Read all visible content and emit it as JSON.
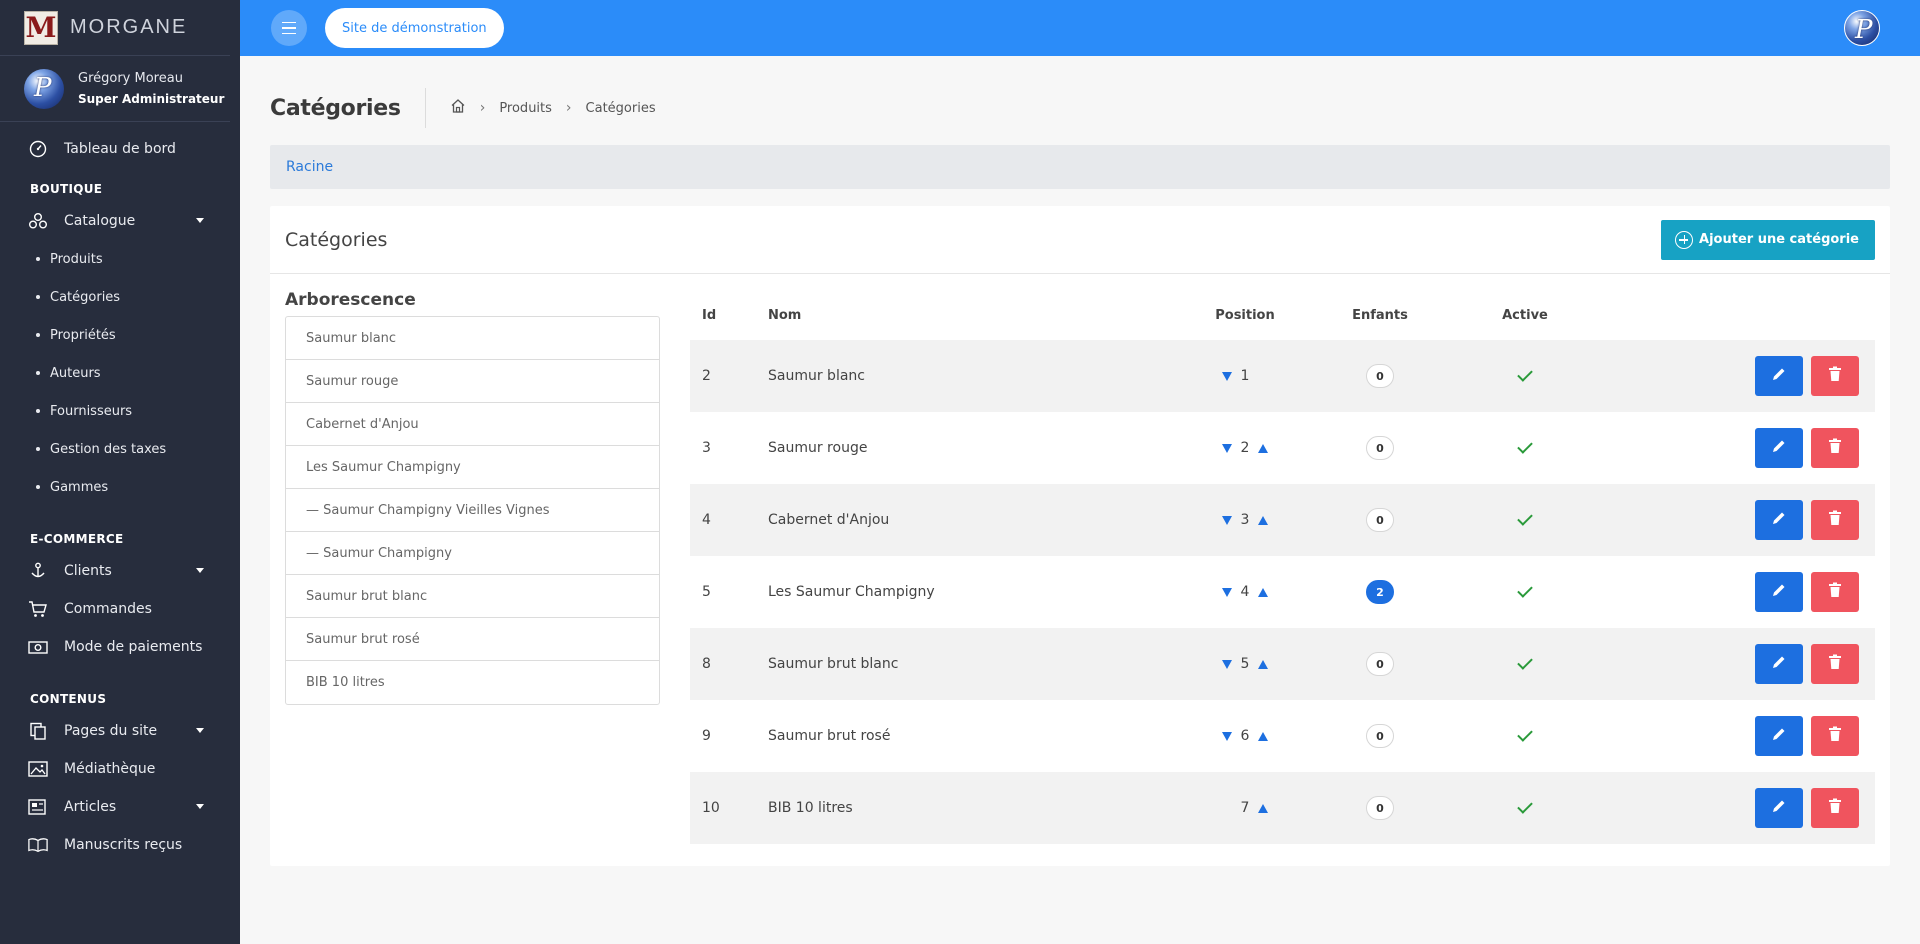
{
  "brand": {
    "logo_letter": "M",
    "name": "MORGANE"
  },
  "user": {
    "name": "Grégory Moreau",
    "role": "Super Administrateur"
  },
  "sidebar": {
    "dashboard": "Tableau de bord",
    "section_boutique": "BOUTIQUE",
    "catalogue": "Catalogue",
    "catalogue_items": [
      "Produits",
      "Catégories",
      "Propriétés",
      "Auteurs",
      "Fournisseurs",
      "Gestion des taxes",
      "Gammes"
    ],
    "section_ecommerce": "E-COMMERCE",
    "clients": "Clients",
    "commandes": "Commandes",
    "paiements": "Mode de paiements",
    "section_contenus": "CONTENUS",
    "pages": "Pages du site",
    "mediatheque": "Médiathèque",
    "articles": "Articles",
    "manuscrits": "Manuscrits reçus"
  },
  "topbar": {
    "site_button": "Site de démonstration"
  },
  "page": {
    "title": "Catégories",
    "breadcrumb": [
      "Produits",
      "Catégories"
    ],
    "root_link": "Racine"
  },
  "card": {
    "title": "Catégories",
    "add_button": "Ajouter une catégorie",
    "tree_title": "Arborescence",
    "tree": [
      "Saumur blanc",
      "Saumur rouge",
      "Cabernet d'Anjou",
      "Les Saumur Champigny",
      "— Saumur Champigny Vieilles Vignes",
      "— Saumur Champigny",
      "Saumur brut blanc",
      "Saumur brut rosé",
      "BIB 10 litres"
    ],
    "columns": {
      "id": "Id",
      "nom": "Nom",
      "position": "Position",
      "enfants": "Enfants",
      "active": "Active"
    },
    "rows": [
      {
        "id": "2",
        "nom": "Saumur blanc",
        "position": "1",
        "enfants": "0",
        "active": true,
        "down": true,
        "up": false
      },
      {
        "id": "3",
        "nom": "Saumur rouge",
        "position": "2",
        "enfants": "0",
        "active": true,
        "down": true,
        "up": true
      },
      {
        "id": "4",
        "nom": "Cabernet d'Anjou",
        "position": "3",
        "enfants": "0",
        "active": true,
        "down": true,
        "up": true
      },
      {
        "id": "5",
        "nom": "Les Saumur Champigny",
        "position": "4",
        "enfants": "2",
        "active": true,
        "down": true,
        "up": true
      },
      {
        "id": "8",
        "nom": "Saumur brut blanc",
        "position": "5",
        "enfants": "0",
        "active": true,
        "down": true,
        "up": true
      },
      {
        "id": "9",
        "nom": "Saumur brut rosé",
        "position": "6",
        "enfants": "0",
        "active": true,
        "down": true,
        "up": true
      },
      {
        "id": "10",
        "nom": "BIB 10 litres",
        "position": "7",
        "enfants": "0",
        "active": true,
        "down": false,
        "up": true
      }
    ]
  },
  "colors": {
    "primary": "#2b8cf9",
    "sidebar": "#272d3d",
    "add_button": "#17a2c4",
    "edit": "#1d6fe0",
    "delete": "#f0545e",
    "check": "#2a9a3a"
  }
}
